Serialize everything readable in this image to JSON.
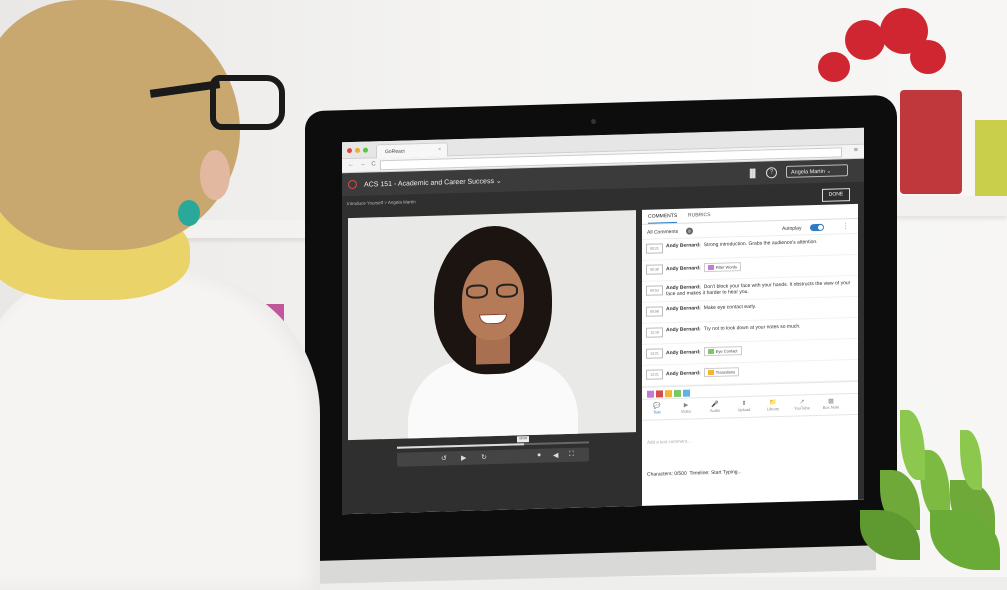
{
  "browser": {
    "tab_title": "GoReact",
    "tab_close": "×",
    "nav": "← → C",
    "menu": "≡",
    "dots": [
      "#e0443e",
      "#f2a93b",
      "#5ac43e"
    ]
  },
  "app": {
    "course_title": "ACS 151 - Academic and Career Success",
    "course_chevron": "⌄",
    "user_name": "Angela Martin",
    "user_chevron": "⌄",
    "help": "?",
    "breadcrumb": "Introduce Yourself > Angela Martin",
    "done_label": "DONE"
  },
  "panel": {
    "tabs": [
      "COMMENTS",
      "RUBRICS"
    ],
    "all_comments_label": "All Comments",
    "all_comments_count": "8",
    "autoplay_label": "Autoplay",
    "autoplay_on": true,
    "comments": [
      {
        "time": "00:21",
        "author": "Andy Bernard:",
        "text": "Strong introduction. Grabs the audience's attention.",
        "tag": "",
        "tag_color": ""
      },
      {
        "time": "00:38",
        "author": "Andy Bernard:",
        "text": "",
        "tag": "Filler Words",
        "tag_color": "#c47ad6"
      },
      {
        "time": "00:53",
        "author": "Andy Bernard:",
        "text": "Don't block your face with your hands. It obstructs the view of your face and makes it harder to hear you.",
        "tag": "",
        "tag_color": ""
      },
      {
        "time": "00:58",
        "author": "Andy Bernard:",
        "text": "Make eye contact early.",
        "tag": "",
        "tag_color": ""
      },
      {
        "time": "13:19",
        "author": "Andy Bernard:",
        "text": "Try not to look down at your notes so much.",
        "tag": "",
        "tag_color": ""
      },
      {
        "time": "13:21",
        "author": "Andy Bernard:",
        "text": "",
        "tag": "Eye Contact",
        "tag_color": "#7cc66a"
      },
      {
        "time": "13:21",
        "author": "Andy Bernard:",
        "text": "",
        "tag": "Transitions",
        "tag_color": "#f2b630"
      }
    ],
    "swatch_colors": [
      "#c47ad6",
      "#d94b4b",
      "#f2b630",
      "#7cc66a",
      "#5bb5e0"
    ],
    "tools": [
      {
        "label": "Text",
        "icon": "💬"
      },
      {
        "label": "Video",
        "icon": "▶"
      },
      {
        "label": "Audio",
        "icon": "🎤"
      },
      {
        "label": "Upload",
        "icon": "⬆"
      },
      {
        "label": "Library",
        "icon": "📁"
      },
      {
        "label": "YouTube",
        "icon": "↗"
      },
      {
        "label": "Box Note",
        "icon": "▦"
      }
    ],
    "placeholder": "Add a text comment...",
    "characters": "Characters: 0/500",
    "timeline": "Timeline: Start Typing..."
  },
  "player": {
    "progress": 0.66,
    "time_tip": "00:58",
    "rewind_icon": "↺",
    "play_icon": "▶",
    "forward_icon": "↻",
    "comment_icon": "●",
    "volume_icon": "◀",
    "fullscreen_icon": "⛶"
  }
}
